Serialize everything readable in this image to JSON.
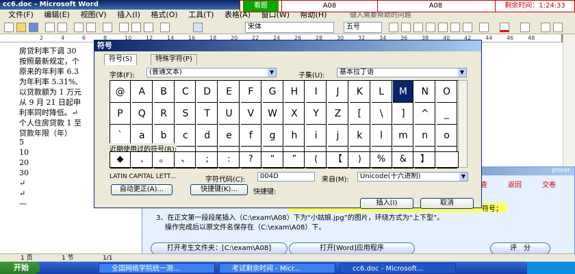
{
  "word": {
    "title": "cc6.doc - Microsoft Word",
    "menus": [
      "文件(F)",
      "编辑(E)",
      "视图(V)",
      "插入(I)",
      "格式(O)",
      "工具(T)",
      "表格(A)",
      "窗口(W)",
      "帮助(H)"
    ],
    "help_hint": "键入需要帮助的问题",
    "font_name": "宋体",
    "font_size": "五号",
    "ruler_numbers": [
      "2",
      "4",
      "6",
      "8",
      "10",
      "12",
      "14",
      "16",
      "18",
      "20",
      "22",
      "24",
      "26",
      "28",
      "30",
      "32",
      "34",
      "36",
      "38",
      "40",
      "42",
      "44",
      "46",
      "48"
    ],
    "doc_lines": [
      "房贷利率下调 30",
      "按照最新规定，个",
      "原来的年利率 6.3",
      "为年利率 5.31%,",
      "以贷款额为 1 万元",
      "从 9 月 21 日起申",
      "利率同时降低。↵",
      "个人住房贷款 1 至",
      "贷款年限（年）",
      "5",
      "10",
      "20",
      "30",
      "↵",
      "↵",
      "—"
    ],
    "status": [
      "1 页",
      "1 节",
      "1/1"
    ]
  },
  "exam": {
    "header_question": "看题",
    "header_id1": "A08",
    "header_id2": "A08",
    "header_time_label": "剩余时间：",
    "header_time": "1:24:33",
    "nav": [
      "查",
      "返回",
      "交卷"
    ],
    "panel_hint": "plorer",
    "highlight": "符号；",
    "task_text1": "3、在正文第一段段尾插入（C:\\exam\\A08）下为“小姑娘.jpg”的图片，环绕方式为“上下型”。",
    "task_text2": "操作完成后以原文件名保存在（C:\\exam\\A08）下。",
    "btn_open_folder": "打开考生文件夹：[C:\\exam\\A08]",
    "btn_open_word": "打开[Word]应用程序",
    "btn_score": "评　分"
  },
  "dialog": {
    "title": "符号",
    "tab_symbols": "符号(S)",
    "tab_special": "特殊字符(P)",
    "font_label": "字体(F):",
    "font_value": "(普通文本)",
    "subset_label": "子集(U):",
    "subset_value": "基本拉丁语",
    "rows": [
      [
        "@",
        "A",
        "B",
        "C",
        "D",
        "E",
        "F",
        "G",
        "H",
        "I",
        "J",
        "K",
        "L",
        "M",
        "N",
        "O"
      ],
      [
        "P",
        "Q",
        "R",
        "S",
        "T",
        "U",
        "V",
        "W",
        "X",
        "Y",
        "Z",
        "[",
        "\\",
        "]",
        "^",
        "_"
      ],
      [
        "`",
        "a",
        "b",
        "c",
        "d",
        "e",
        "f",
        "g",
        "h",
        "i",
        "j",
        "k",
        "l",
        "m",
        "n",
        "o"
      ],
      [
        "p",
        "q",
        "r",
        "s",
        "t",
        "u",
        "v",
        "w",
        "x",
        "y",
        "z",
        "{",
        "|",
        "}",
        "~",
        ""
      ]
    ],
    "selected": "M",
    "recent_label": "近期使用过的符号(R):",
    "recent": [
      "◆",
      ",",
      "。",
      "、",
      ";",
      ":",
      "?",
      "“",
      "”",
      "(",
      "【",
      ")",
      "%",
      "&",
      "】"
    ],
    "char_name": "LATIN CAPITAL LETT...",
    "code_label": "字符代码(C):",
    "code_value": "004D",
    "from_label": "来自(M):",
    "from_value": "Unicode(十六进制)",
    "autocorrect": "自动更正(A)...",
    "shortcut_btn": "快捷键(K)...",
    "shortcut_label": "快捷键:",
    "insert": "插入(I)",
    "cancel": "取消"
  },
  "taskbar": {
    "start": "开始",
    "tasks": [
      "全国网络学院统一测...",
      "考试剩余时间 - Micr...",
      "cc6.doc - Microsoft..."
    ],
    "tray_time": ""
  }
}
